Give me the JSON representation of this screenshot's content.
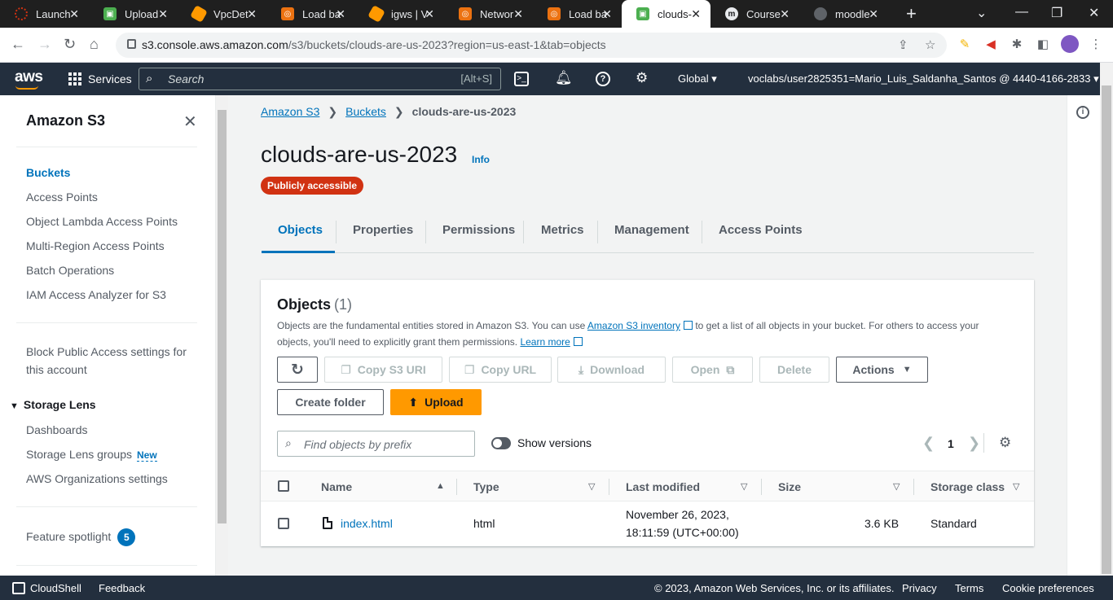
{
  "browser": {
    "tabs": [
      {
        "title": "Launch",
        "icon": "launch-icon",
        "color": "#d13212",
        "active": false
      },
      {
        "title": "Upload",
        "icon": "upload-icon",
        "color": "#4caf50",
        "active": false
      },
      {
        "title": "VpcDet",
        "icon": "vpc-icon",
        "color": "#ff9900",
        "active": false
      },
      {
        "title": "Load ba",
        "icon": "loadbalancer-icon",
        "color": "#ec7211",
        "active": false
      },
      {
        "title": "igws | V",
        "icon": "igw-icon",
        "color": "#ff9900",
        "active": false
      },
      {
        "title": "Networ",
        "icon": "network-icon",
        "color": "#ec7211",
        "active": false
      },
      {
        "title": "Load ba",
        "icon": "loadbalancer-icon",
        "color": "#ec7211",
        "active": false
      },
      {
        "title": "clouds-",
        "icon": "s3-icon",
        "color": "#4caf50",
        "active": true
      },
      {
        "title": "Course",
        "icon": "course-icon",
        "color": "#3c3c3c",
        "active": false
      },
      {
        "title": "moodle",
        "icon": "globe-icon",
        "color": "#5f6368",
        "active": false
      }
    ],
    "url_host": "s3.console.aws.amazon.com",
    "url_path": "/s3/buckets/clouds-are-us-2023?region=us-east-1&tab=objects"
  },
  "awsnav": {
    "logo": "aws",
    "services": "Services",
    "search_placeholder": "Search",
    "search_shortcut": "[Alt+S]",
    "region": "Global",
    "account": "voclabs/user2825351=Mario_Luis_Saldanha_Santos @ 4440-4166-2833"
  },
  "sidebar": {
    "title": "Amazon S3",
    "items": [
      {
        "label": "Buckets"
      },
      {
        "label": "Access Points"
      },
      {
        "label": "Object Lambda Access Points"
      },
      {
        "label": "Multi-Region Access Points"
      },
      {
        "label": "Batch Operations"
      },
      {
        "label": "IAM Access Analyzer for S3"
      }
    ],
    "block_public": "Block Public Access settings for this account",
    "storage_lens": {
      "title": "Storage Lens",
      "items": [
        {
          "label": "Dashboards"
        },
        {
          "label": "Storage Lens groups",
          "badge": "New"
        },
        {
          "label": "AWS Organizations settings"
        }
      ]
    },
    "feature_spotlight": {
      "label": "Feature spotlight",
      "count": "5"
    }
  },
  "breadcrumb": {
    "items": [
      "Amazon S3",
      "Buckets"
    ],
    "current": "clouds-are-us-2023"
  },
  "bucket": {
    "name": "clouds-are-us-2023",
    "info": "Info",
    "badge": "Publicly accessible"
  },
  "tabs": [
    "Objects",
    "Properties",
    "Permissions",
    "Metrics",
    "Management",
    "Access Points"
  ],
  "objects_panel": {
    "title": "Objects",
    "count": "(1)",
    "desc_1": "Objects are the fundamental entities stored in Amazon S3. You can use ",
    "desc_link_1": "Amazon S3 inventory",
    "desc_2": " to get a list of all objects in your bucket. For others to access your objects, you'll need to explicitly grant them permissions. ",
    "desc_link_2": "Learn more",
    "buttons": {
      "refresh": "",
      "copy_s3_uri": "Copy S3 URI",
      "copy_url": "Copy URL",
      "download": "Download",
      "open": "Open",
      "delete": "Delete",
      "actions": "Actions",
      "create_folder": "Create folder",
      "upload": "Upload"
    },
    "find_placeholder": "Find objects by prefix",
    "show_versions": "Show versions",
    "page": "1",
    "columns": [
      "Name",
      "Type",
      "Last modified",
      "Size",
      "Storage class"
    ],
    "rows": [
      {
        "name": "index.html",
        "type": "html",
        "modified_1": "November 26, 2023,",
        "modified_2": "18:11:59 (UTC+00:00)",
        "size": "3.6 KB",
        "storage": "Standard"
      }
    ]
  },
  "footer": {
    "cloudshell": "CloudShell",
    "feedback": "Feedback",
    "copyright": "© 2023, Amazon Web Services, Inc. or its affiliates.",
    "privacy": "Privacy",
    "terms": "Terms",
    "cookies": "Cookie preferences"
  },
  "colors": {
    "aws_nav": "#232f3e",
    "link": "#0073bb",
    "primary": "#ff9900",
    "danger_badge": "#d13212"
  }
}
